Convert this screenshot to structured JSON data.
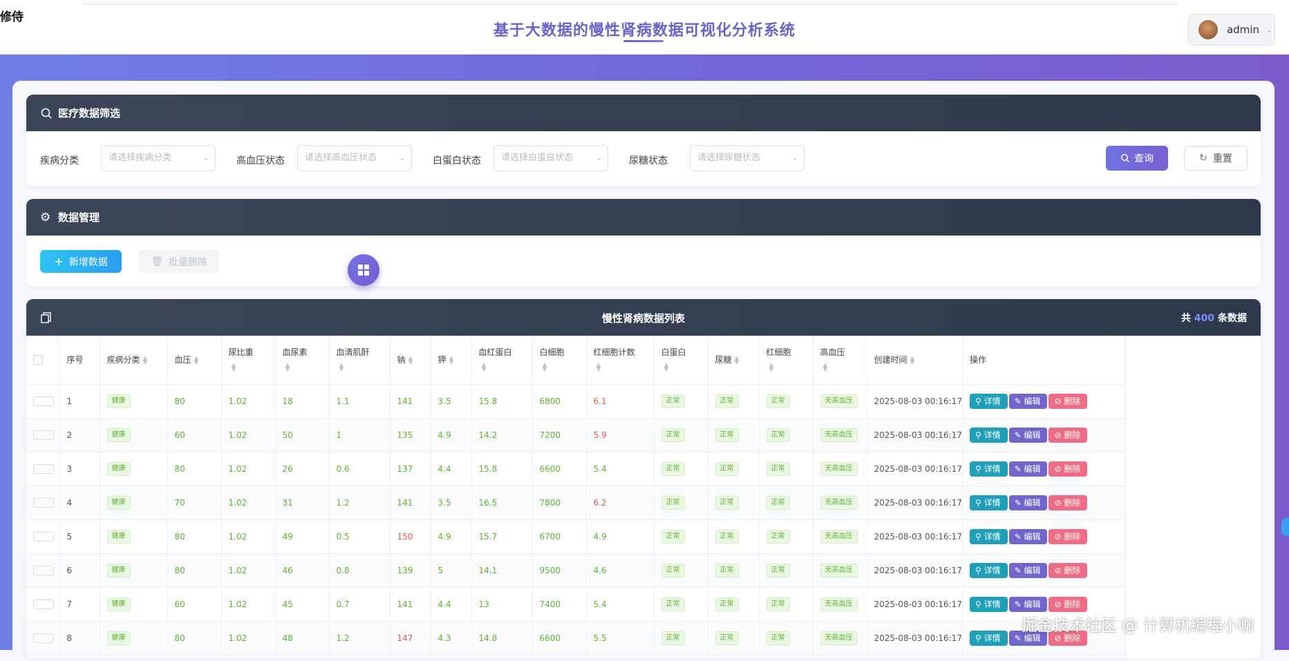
{
  "topbar": {
    "corner_mark": "修侍",
    "title": "基于大数据的慢性肾病数据可视化分析系统",
    "user": "admin"
  },
  "filter": {
    "title": "医疗数据筛选",
    "fields": [
      {
        "label": "疾病分类",
        "placeholder": "请选择疾病分类"
      },
      {
        "label": "高血压状态",
        "placeholder": "请选择高血压状态"
      },
      {
        "label": "白蛋白状态",
        "placeholder": "请选择白蛋白状态"
      },
      {
        "label": "尿糖状态",
        "placeholder": "请选择尿糖状态"
      }
    ],
    "query_label": "查询",
    "reset_label": "重置"
  },
  "manage": {
    "title": "数据管理",
    "add_label": "新增数据",
    "batch_delete_label": "批量删除"
  },
  "table": {
    "title": "慢性肾病数据列表",
    "count_prefix": "共",
    "count": "400",
    "count_suffix": "条数据",
    "columns": [
      "序号",
      "疾病分类",
      "血压",
      "尿比重",
      "血尿素",
      "血清肌酐",
      "钠",
      "钾",
      "血红蛋白",
      "白细胞",
      "红细胞计数",
      "白蛋白",
      "尿糖",
      "红细胞",
      "高血压",
      "创建时间",
      "操作"
    ],
    "actions": {
      "detail": "详情",
      "edit": "编辑",
      "delete": "删除"
    },
    "rows": [
      {
        "id": "1",
        "category": "健康",
        "bp": "80",
        "sg": "1.02",
        "bu": "18",
        "sc": "1.1",
        "sod": "141",
        "pot": "3.5",
        "hemo": "15.8",
        "wbc": "6800",
        "rbcc": "6.1",
        "alb": "正常",
        "su": "正常",
        "rbc": "正常",
        "htn": "无高血压",
        "time": "2025-08-03 00:16:17"
      },
      {
        "id": "2",
        "category": "健康",
        "bp": "60",
        "sg": "1.02",
        "bu": "50",
        "sc": "1",
        "sod": "135",
        "pot": "4.9",
        "hemo": "14.2",
        "wbc": "7200",
        "rbcc": "5.9",
        "alb": "正常",
        "su": "正常",
        "rbc": "正常",
        "htn": "无高血压",
        "time": "2025-08-03 00:16:17"
      },
      {
        "id": "3",
        "category": "健康",
        "bp": "80",
        "sg": "1.02",
        "bu": "26",
        "sc": "0.6",
        "sod": "137",
        "pot": "4.4",
        "hemo": "15.8",
        "wbc": "6600",
        "rbcc": "5.4",
        "alb": "正常",
        "su": "正常",
        "rbc": "正常",
        "htn": "无高血压",
        "time": "2025-08-03 00:16:17"
      },
      {
        "id": "4",
        "category": "健康",
        "bp": "70",
        "sg": "1.02",
        "bu": "31",
        "sc": "1.2",
        "sod": "141",
        "pot": "3.5",
        "hemo": "16.5",
        "wbc": "7800",
        "rbcc": "6.2",
        "alb": "正常",
        "su": "正常",
        "rbc": "正常",
        "htn": "无高血压",
        "time": "2025-08-03 00:16:17"
      },
      {
        "id": "5",
        "category": "健康",
        "bp": "80",
        "sg": "1.02",
        "bu": "49",
        "sc": "0.5",
        "sod": "150",
        "pot": "4.9",
        "hemo": "15.7",
        "wbc": "6700",
        "rbcc": "4.9",
        "alb": "正常",
        "su": "正常",
        "rbc": "正常",
        "htn": "无高血压",
        "time": "2025-08-03 00:16:17"
      },
      {
        "id": "6",
        "category": "健康",
        "bp": "80",
        "sg": "1.02",
        "bu": "46",
        "sc": "0.8",
        "sod": "139",
        "pot": "5",
        "hemo": "14.1",
        "wbc": "9500",
        "rbcc": "4.6",
        "alb": "正常",
        "su": "正常",
        "rbc": "正常",
        "htn": "无高血压",
        "time": "2025-08-03 00:16:17"
      },
      {
        "id": "7",
        "category": "健康",
        "bp": "60",
        "sg": "1.02",
        "bu": "45",
        "sc": "0.7",
        "sod": "141",
        "pot": "4.4",
        "hemo": "13",
        "wbc": "7400",
        "rbcc": "5.4",
        "alb": "正常",
        "su": "正常",
        "rbc": "正常",
        "htn": "无高血压",
        "time": "2025-08-03 00:16:17"
      },
      {
        "id": "8",
        "category": "健康",
        "bp": "80",
        "sg": "1.02",
        "bu": "48",
        "sc": "1.2",
        "sod": "147",
        "pot": "4.3",
        "hemo": "14.8",
        "wbc": "6600",
        "rbcc": "5.5",
        "alb": "正常",
        "su": "正常",
        "rbc": "正常",
        "htn": "无高血压",
        "time": "2025-08-03 00:16:17"
      }
    ]
  },
  "watermark": "掘金技术社区 @ 计算机编程小咖",
  "colors": {
    "accent": "#6a63c9",
    "header_dark": "#2e3a4b",
    "ok_green": "#5fb234",
    "warn_red": "#e05a4f"
  }
}
